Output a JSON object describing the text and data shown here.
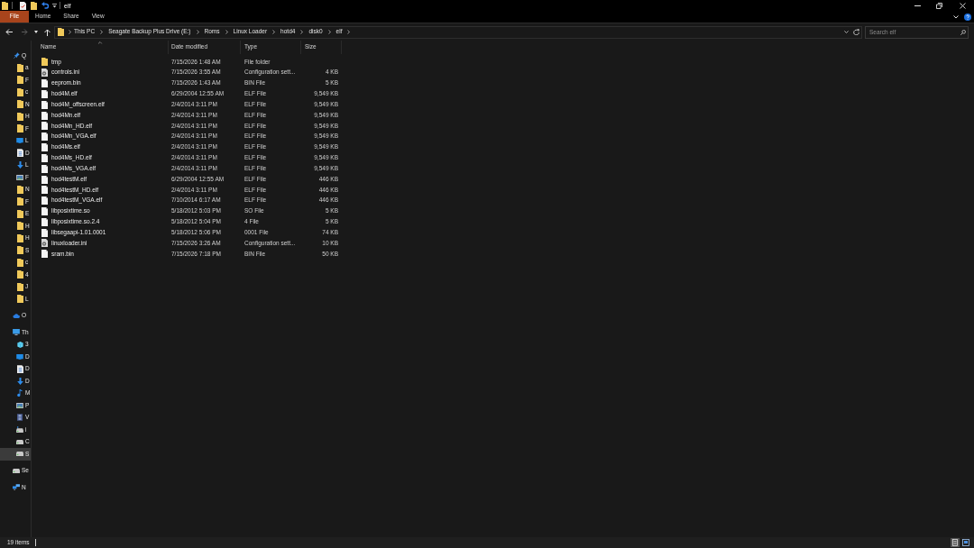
{
  "window": {
    "title": "elf"
  },
  "ribbon_tabs": [
    {
      "label": "File",
      "kind": "file_menu"
    },
    {
      "label": "Home",
      "kind": "tab"
    },
    {
      "label": "Share",
      "kind": "tab"
    },
    {
      "label": "View",
      "kind": "tab"
    }
  ],
  "navigation": [
    {
      "kind": "back",
      "disabled": false
    },
    {
      "kind": "forward",
      "disabled": true
    },
    {
      "kind": "recent",
      "disabled": false
    },
    {
      "kind": "up",
      "disabled": false
    }
  ],
  "address_bar": {
    "path": [
      "This PC",
      "Seagate Backup Plus Drive (E:)",
      "Roms",
      "Linux Loader",
      "hotd4",
      "disk0",
      "elf"
    ]
  },
  "search": {
    "placeholder": "Search elf"
  },
  "sidebar": {
    "items": [
      {
        "label": "Q",
        "kind": "pin",
        "selected": false,
        "children": [
          {
            "label": "a",
            "kind": "folder",
            "selected": false
          },
          {
            "label": "F",
            "kind": "folder",
            "selected": false
          },
          {
            "label": "c",
            "kind": "folder",
            "selected": false
          },
          {
            "label": "N",
            "kind": "folder",
            "selected": false
          },
          {
            "label": "H",
            "kind": "folder",
            "selected": false
          },
          {
            "label": "F",
            "kind": "folder",
            "selected": false
          },
          {
            "label": "L",
            "kind": "desktop",
            "selected": false
          },
          {
            "label": "D",
            "kind": "document",
            "selected": false
          },
          {
            "label": "L",
            "kind": "download",
            "selected": false
          },
          {
            "label": "F",
            "kind": "pictures",
            "selected": false
          },
          {
            "label": "N",
            "kind": "folder",
            "selected": false
          },
          {
            "label": "F",
            "kind": "folder",
            "selected": false
          },
          {
            "label": "E",
            "kind": "folder",
            "selected": false
          },
          {
            "label": "H",
            "kind": "folder",
            "selected": false
          },
          {
            "label": "H",
            "kind": "folder",
            "selected": false
          },
          {
            "label": "S",
            "kind": "folder",
            "selected": false
          },
          {
            "label": "c",
            "kind": "folder",
            "selected": false
          },
          {
            "label": "4",
            "kind": "folder",
            "selected": false
          },
          {
            "label": "J",
            "kind": "folder",
            "selected": false
          },
          {
            "label": "L",
            "kind": "folder",
            "selected": false
          }
        ]
      },
      {
        "label": "O",
        "kind": "cloud",
        "selected": false
      },
      {
        "label": "Th",
        "kind": "pc",
        "selected": false,
        "children": [
          {
            "label": "3",
            "kind": "cube",
            "selected": false
          },
          {
            "label": "D",
            "kind": "desktop",
            "selected": false
          },
          {
            "label": "D",
            "kind": "document",
            "selected": false
          },
          {
            "label": "D",
            "kind": "download",
            "selected": false
          },
          {
            "label": "M",
            "kind": "music",
            "selected": false
          },
          {
            "label": "P",
            "kind": "pictures",
            "selected": false
          },
          {
            "label": "V",
            "kind": "video",
            "selected": false
          },
          {
            "label": "i",
            "kind": "netdrive",
            "selected": false
          },
          {
            "label": "C",
            "kind": "drive",
            "selected": false
          },
          {
            "label": "S",
            "kind": "drive",
            "selected": true
          }
        ]
      },
      {
        "label": "Se",
        "kind": "drive",
        "selected": false
      },
      {
        "label": "N",
        "kind": "network",
        "selected": false
      }
    ]
  },
  "file_list": {
    "columns": [
      {
        "label": "Name",
        "sorted": true
      },
      {
        "label": "Date modified",
        "sorted": false
      },
      {
        "label": "Type",
        "sorted": false
      },
      {
        "label": "Size",
        "sorted": false
      }
    ],
    "rows": [
      {
        "name": "tmp",
        "kind": "folder",
        "date": "7/15/2026 1:48 AM",
        "type": "File folder"
      },
      {
        "name": "controls.ini",
        "kind": "config",
        "date": "7/15/2026 3:55 AM",
        "type": "Configuration sett...",
        "size": "4 KB"
      },
      {
        "name": "eeprom.bin",
        "kind": "file",
        "date": "7/15/2026 1:43 AM",
        "type": "BIN File",
        "size": "5 KB"
      },
      {
        "name": "hod4M.elf",
        "kind": "file",
        "date": "6/29/2004 12:55 AM",
        "type": "ELF File",
        "size": "9,549 KB"
      },
      {
        "name": "hod4M_offscreen.elf",
        "kind": "file",
        "date": "2/4/2014 3:11 PM",
        "type": "ELF File",
        "size": "9,549 KB"
      },
      {
        "name": "hod4Mn.elf",
        "kind": "file",
        "date": "2/4/2014 3:11 PM",
        "type": "ELF File",
        "size": "9,549 KB"
      },
      {
        "name": "hod4Mn_HD.elf",
        "kind": "file",
        "date": "2/4/2014 3:11 PM",
        "type": "ELF File",
        "size": "9,549 KB"
      },
      {
        "name": "hod4Mn_VGA.elf",
        "kind": "file",
        "date": "2/4/2014 3:11 PM",
        "type": "ELF File",
        "size": "9,549 KB"
      },
      {
        "name": "hod4Ms.elf",
        "kind": "file",
        "date": "2/4/2014 3:11 PM",
        "type": "ELF File",
        "size": "9,549 KB"
      },
      {
        "name": "hod4Ms_HD.elf",
        "kind": "file",
        "date": "2/4/2014 3:11 PM",
        "type": "ELF File",
        "size": "9,549 KB"
      },
      {
        "name": "hod4Ms_VGA.elf",
        "kind": "file",
        "date": "2/4/2014 3:11 PM",
        "type": "ELF File",
        "size": "9,549 KB"
      },
      {
        "name": "hod4testM.elf",
        "kind": "file",
        "date": "6/29/2004 12:55 AM",
        "type": "ELF File",
        "size": "446 KB"
      },
      {
        "name": "hod4testM_HD.elf",
        "kind": "file",
        "date": "2/4/2014 3:11 PM",
        "type": "ELF File",
        "size": "446 KB"
      },
      {
        "name": "hod4testM_VGA.elf",
        "kind": "file",
        "date": "7/10/2014 6:17 AM",
        "type": "ELF File",
        "size": "446 KB"
      },
      {
        "name": "libposixtime.so",
        "kind": "file",
        "date": "5/18/2012 5:03 PM",
        "type": "SO File",
        "size": "5 KB"
      },
      {
        "name": "libposixtime.so.2.4",
        "kind": "file",
        "date": "5/18/2012 5:04 PM",
        "type": "4 File",
        "size": "5 KB"
      },
      {
        "name": "libsegaapi-1.01.0001",
        "kind": "file",
        "date": "5/18/2012 5:06 PM",
        "type": "0001 File",
        "size": "74 KB"
      },
      {
        "name": "linuxloader.ini",
        "kind": "config",
        "date": "7/15/2026 3:26 AM",
        "type": "Configuration sett...",
        "size": "10 KB"
      },
      {
        "name": "sram.bin",
        "kind": "file",
        "date": "7/15/2026 7:18 PM",
        "type": "BIN File",
        "size": "50 KB"
      }
    ]
  },
  "status_bar": {
    "text": "19 items",
    "views": [
      {
        "kind": "details",
        "selected": true
      },
      {
        "kind": "large_icons",
        "selected": false
      }
    ]
  }
}
